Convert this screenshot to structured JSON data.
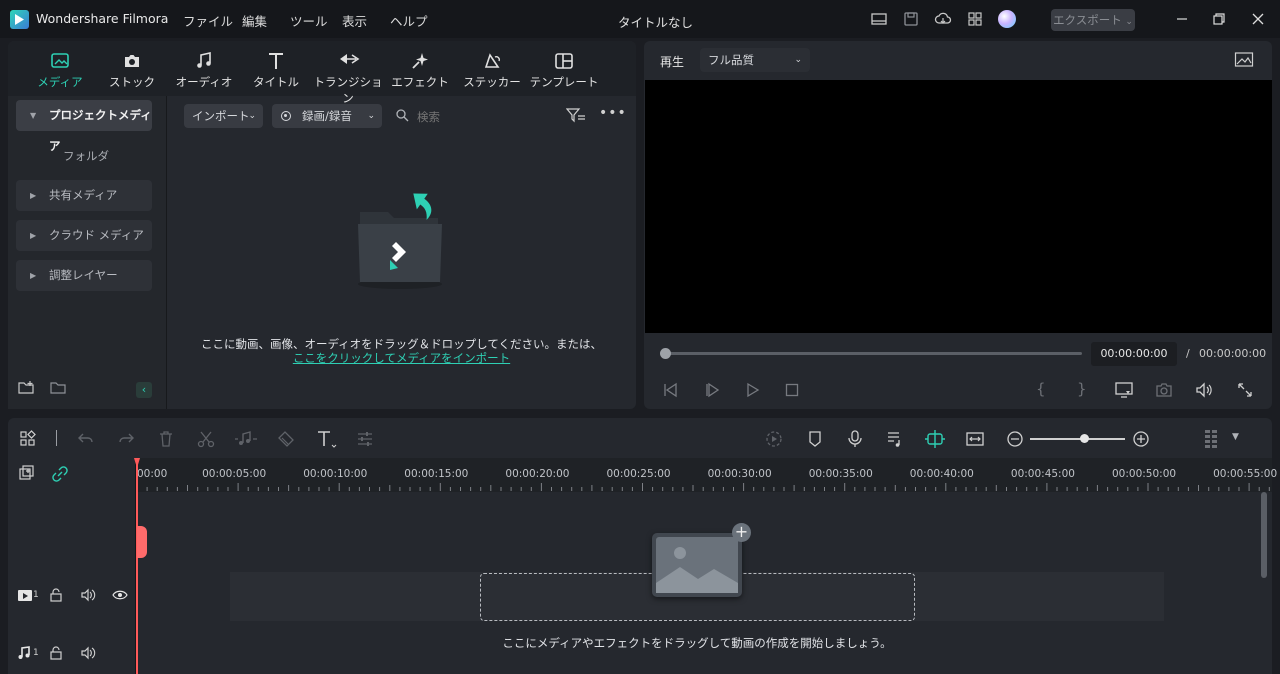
{
  "app": {
    "name": "Wondershare Filmora",
    "window_title": "タイトルなし"
  },
  "menu": [
    "ファイル",
    "編集",
    "ツール",
    "表示",
    "ヘルプ"
  ],
  "export_label": "エクスポート",
  "tabs": [
    {
      "label": "メディア",
      "icon": "media-icon"
    },
    {
      "label": "ストック",
      "icon": "stock-icon"
    },
    {
      "label": "オーディオ",
      "icon": "audio-icon"
    },
    {
      "label": "タイトル",
      "icon": "title-icon"
    },
    {
      "label": "トランジション",
      "icon": "transition-icon"
    },
    {
      "label": "エフェクト",
      "icon": "effect-icon"
    },
    {
      "label": "ステッカー",
      "icon": "sticker-icon"
    },
    {
      "label": "テンプレート",
      "icon": "template-icon"
    }
  ],
  "sidebar": {
    "project_media": "プロジェクトメディア",
    "folder": "フォルダ",
    "items": [
      "共有メディア",
      "クラウド メディア",
      "調整レイヤー"
    ]
  },
  "media_toolbar": {
    "import": "インポート",
    "record": "録画/録音",
    "search_placeholder": "検索"
  },
  "media_empty": {
    "text": "ここに動画、画像、オーディオをドラッグ＆ドロップしてください。または、",
    "link": "ここをクリックしてメディアをインポート"
  },
  "preview": {
    "play_label": "再生",
    "quality": "フル品質",
    "current_time": "00:00:00:00",
    "separator": "/",
    "total_time": "00:00:00:00"
  },
  "timeline": {
    "ticks": [
      "00:00",
      "00:00:05:00",
      "00:00:10:00",
      "00:00:15:00",
      "00:00:20:00",
      "00:00:25:00",
      "00:00:30:00",
      "00:00:35:00",
      "00:00:40:00",
      "00:00:45:00",
      "00:00:50:00",
      "00:00:55:00"
    ],
    "drop_text": "ここにメディアやエフェクトをドラッグして動画の作成を開始しましょう。",
    "video_track": "1",
    "audio_track": "1"
  },
  "colors": {
    "accent": "#2ed0b4",
    "playhead": "#ff5a5a",
    "link": "#2ed0b4"
  }
}
